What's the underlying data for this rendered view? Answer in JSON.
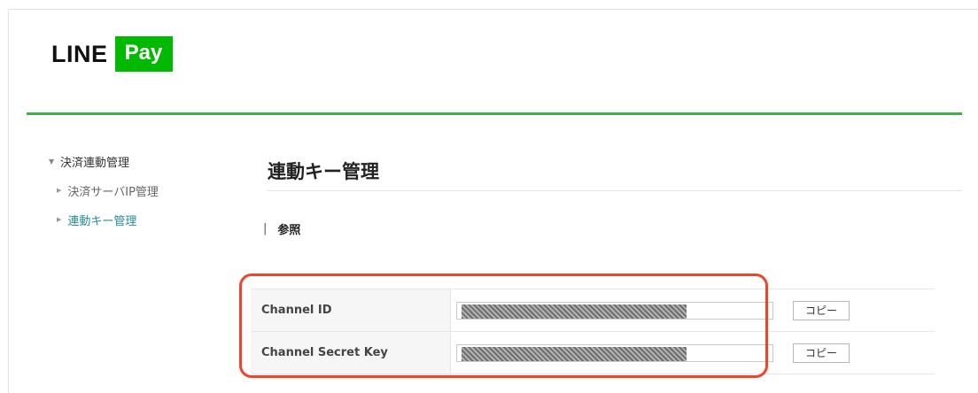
{
  "logo": {
    "line_text": "LINE",
    "pay_text": "Pay",
    "brand_color": "#00b900"
  },
  "sidebar": {
    "parent_label": "決済連動管理",
    "items": [
      {
        "label": "決済サーバIP管理",
        "active": false
      },
      {
        "label": "連動キー管理",
        "active": true
      }
    ]
  },
  "main": {
    "title": "連動キー管理",
    "section_label": "参照",
    "rows": [
      {
        "label": "Channel ID",
        "value": "",
        "button": "コピー"
      },
      {
        "label": "Channel Secret Key",
        "value": "",
        "button": "コピー"
      }
    ]
  },
  "colors": {
    "accent_rule": "#3fb14a",
    "active_link": "#2a8a99",
    "highlight_border": "#e9472a"
  }
}
